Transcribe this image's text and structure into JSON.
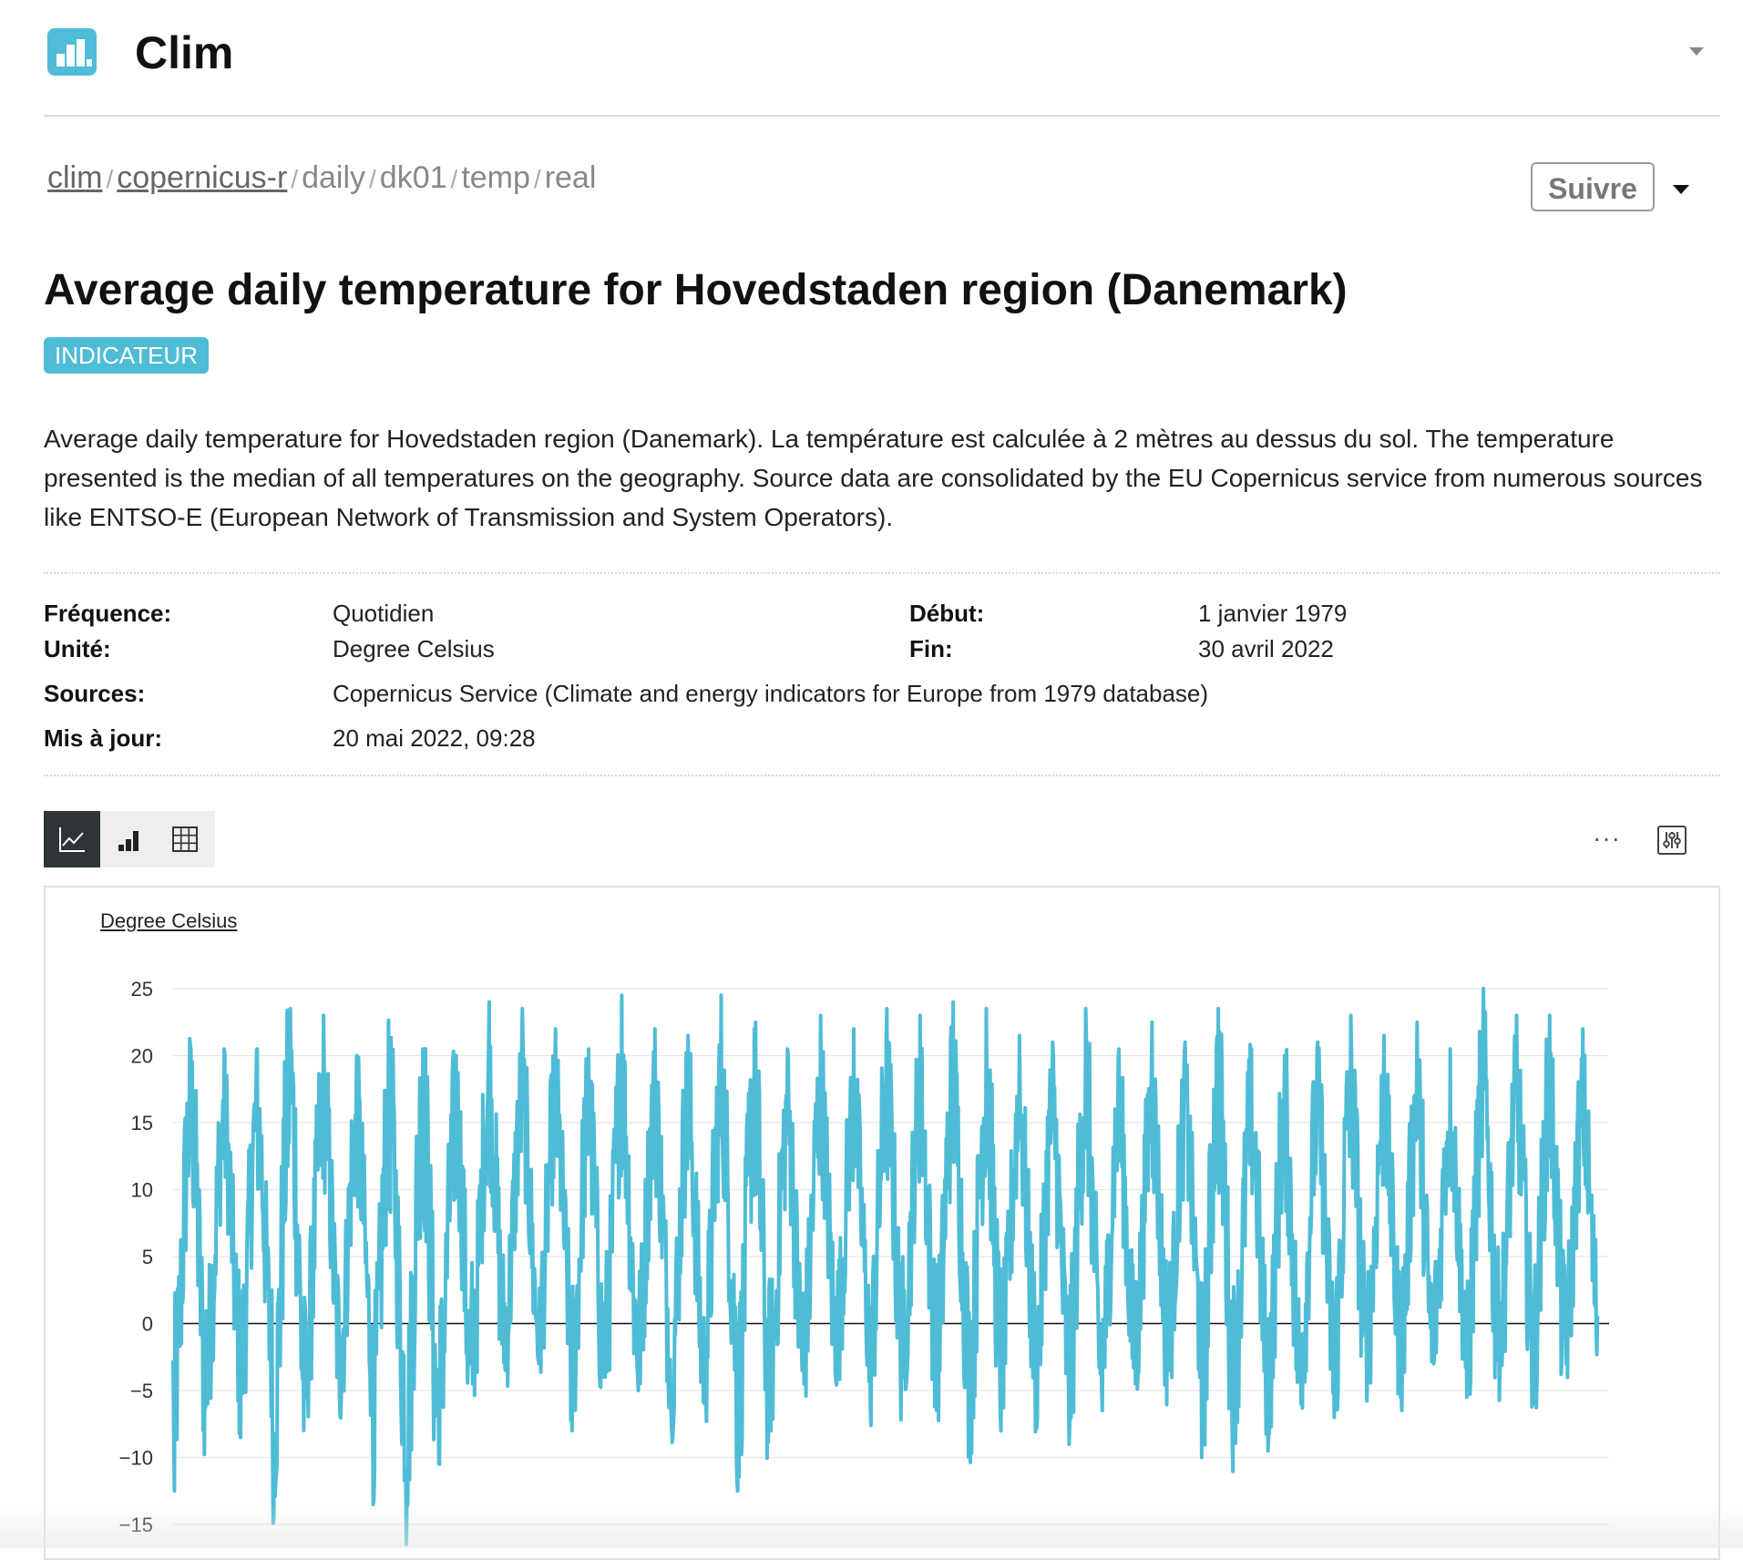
{
  "app": {
    "title": "Clim"
  },
  "breadcrumb": {
    "links": [
      "clim",
      "copernicus-r"
    ],
    "parts": [
      "daily",
      "dk01",
      "temp",
      "real"
    ],
    "separator": "/"
  },
  "actions": {
    "follow_label": "Suivre"
  },
  "page": {
    "title": "Average daily temperature for Hovedstaden region (Danemark)",
    "badge": "INDICATEUR",
    "description": "Average daily temperature for Hovedstaden region (Danemark). La température est calculée à 2 mètres au dessus du sol. The temperature presented is the median of all temperatures on the geography. Source data are consolidated by the EU Copernicus service from numerous sources like ENTSO-E (European Network of Transmission and System Operators)."
  },
  "meta": {
    "frequency_label": "Fréquence:",
    "frequency": "Quotidien",
    "unit_label": "Unité:",
    "unit": "Degree Celsius",
    "start_label": "Début:",
    "start": "1 janvier 1979",
    "end_label": "Fin:",
    "end": "30 avril 2022",
    "sources_label": "Sources:",
    "sources": "Copernicus Service (Climate and energy indicators for Europe from 1979 database)",
    "updated_label": "Mis à jour:",
    "updated": "20 mai 2022, 09:28"
  },
  "view_toggle": {
    "active": "line"
  },
  "chart_data": {
    "type": "line",
    "ylabel": "Degree Celsius",
    "xlim": [
      "1979-01-01",
      "2022-04-30"
    ],
    "ylim": [
      -15,
      25
    ],
    "yticks": [
      "25",
      "20",
      "15",
      "10",
      "5",
      "0",
      "−5",
      "−10",
      "−15"
    ],
    "series": [
      {
        "color": "#4fbcd6",
        "x_start_year": 1979,
        "x_end_year": 2022.33,
        "note": "daily values; annual extremes estimated from chart",
        "annual_max": [
          20.5,
          20.5,
          20.5,
          23.5,
          23.0,
          20.0,
          20.5,
          20.5,
          20.0,
          24.0,
          23.5,
          22.0,
          20.5,
          24.5,
          22.0,
          21.5,
          24.5,
          22.0,
          20.5,
          23.0,
          22.0,
          23.5,
          23.0,
          24.0,
          23.5,
          21.5,
          21.0,
          23.5,
          20.5,
          22.5,
          21.0,
          23.5,
          20.5,
          20.0,
          21.0,
          23.0,
          21.5,
          22.5,
          20.5,
          25.0,
          23.0,
          23.0,
          22.0
        ],
        "annual_min": [
          -12.5,
          -6.0,
          -8.5,
          -14.5,
          -5.5,
          -7.0,
          -13.5,
          -16.5,
          -10.5,
          -4.5,
          -2.5,
          -3.0,
          -8.0,
          -4.0,
          -5.0,
          -7.5,
          -6.0,
          -12.5,
          -8.0,
          -4.5,
          -3.0,
          -6.0,
          -4.0,
          -6.5,
          -9.0,
          -5.5,
          -7.5,
          -9.0,
          -6.5,
          -4.5,
          -3.5,
          -10.0,
          -8.0,
          -9.5,
          -6.0,
          -7.0,
          -4.0,
          -5.5,
          -3.0,
          -5.5,
          -3.0,
          -6.0,
          -3.0
        ]
      }
    ]
  }
}
